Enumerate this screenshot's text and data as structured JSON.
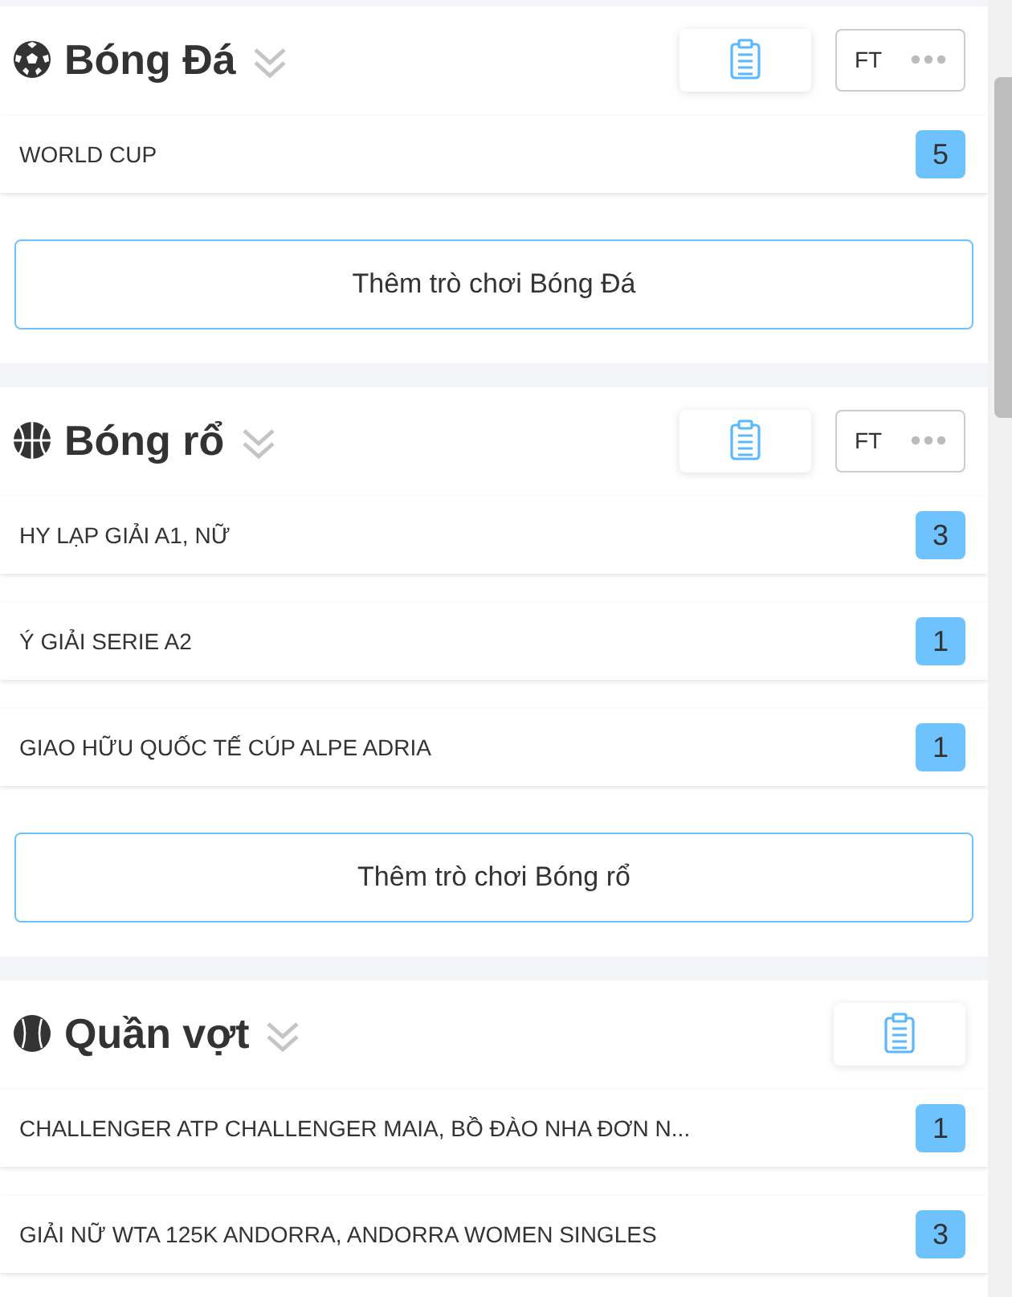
{
  "sections": [
    {
      "kind": "football",
      "title": "Bóng Đá",
      "ft_label": "FT",
      "leagues": [
        {
          "name": "WORLD CUP",
          "count": "5"
        }
      ],
      "add_button": "Thêm trò chơi Bóng Đá"
    },
    {
      "kind": "basketball",
      "title": "Bóng rổ",
      "ft_label": "FT",
      "leagues": [
        {
          "name": "HY LẠP GIẢI A1, NỮ",
          "count": "3"
        },
        {
          "name": "Ý GIẢI SERIE A2",
          "count": "1"
        },
        {
          "name": "GIAO HỮU QUỐC TẾ CÚP ALPE ADRIA",
          "count": "1"
        }
      ],
      "add_button": "Thêm trò chơi Bóng rổ"
    },
    {
      "kind": "tennis",
      "title": "Quần vợt",
      "leagues": [
        {
          "name": "CHALLENGER ATP CHALLENGER MAIA, BỒ ĐÀO NHA ĐƠN N...",
          "count": "1"
        },
        {
          "name": "GIẢI NỮ WTA 125K ANDORRA, ANDORRA WOMEN SINGLES",
          "count": "3"
        }
      ]
    }
  ]
}
